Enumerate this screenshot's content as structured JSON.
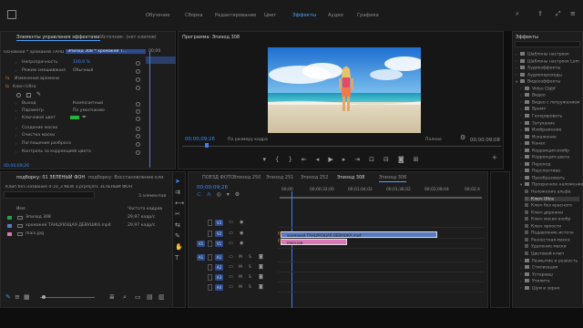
{
  "workspaces": [
    "Обучение",
    "Сборка",
    "Редактирование",
    "Цвет",
    "Эффекты",
    "Аудио",
    "Графика"
  ],
  "active_workspace": "Эффекты",
  "effect_controls": {
    "tabs": [
      "Элементы управления эффектами",
      "Источник: (нет клипов)"
    ],
    "header_master": "Основной * хромакей ТАНЦ...",
    "header_seq": "Эпизод 308 * хромакей Т...",
    "timecode_top": "00;00",
    "rows": [
      {
        "label": "Непрозрачность",
        "value": "100,0 %"
      },
      {
        "label": "Режим смешивания",
        "value": "Обычный"
      },
      {
        "label": "Изменение времени",
        "value": ""
      },
      {
        "label": "Ключ Ultra",
        "value": ""
      },
      {
        "label": "Выход",
        "value": "Композитный"
      },
      {
        "label": "Параметр",
        "value": "По умолчанию"
      },
      {
        "label": "Ключевой цвет",
        "value": ""
      },
      {
        "label": "Создание маски",
        "value": ""
      },
      {
        "label": "Очистка маски",
        "value": ""
      },
      {
        "label": "Поглощение разброса",
        "value": ""
      },
      {
        "label": "Контроль за коррекцией цвета",
        "value": ""
      },
      {
        "label": "Коррекция цвета",
        "value": ""
      }
    ],
    "timecode": "00;00;09;26"
  },
  "program": {
    "title": "Программа: Эпизод 308",
    "timecode": "00;00;09;26",
    "fit": "По размеру кадра",
    "quality": "Полное",
    "duration": "00;00;09;08"
  },
  "project": {
    "tabs": [
      "подборку: 01 ЗЕЛЕНЫЙ ФОН",
      "подборку: Восстановление кли"
    ],
    "path": "Клип без названия 4-10_3 NEW 3.prproj\\01 ЗЕЛЕНЫЙ ФОН",
    "count": "3 элементов",
    "col_name": "Имя",
    "col_rate": "Частота кадров",
    "items": [
      {
        "name": "Эпизод 308",
        "rate": "29,97 кадр/с",
        "color": "#2e9b4a"
      },
      {
        "name": "хромакей ТАНЦУЮЩАЯ ДЕВУШКА.mp4",
        "rate": "29,97 кадр/с",
        "color": "#5a7ac0"
      },
      {
        "name": "main.jpg",
        "rate": "",
        "color": "#d977b8"
      }
    ]
  },
  "timeline": {
    "tabs": [
      "ПОЕЗД ФОТО",
      "Эпизод 250",
      "Эпизод 251",
      "Эпизод 252",
      "Эпизод 308",
      "Эпизод 306"
    ],
    "active_tab": "Эпизод 308",
    "timecode": "00;00;09;26",
    "ruler": [
      "00;00",
      "00;00;32;00",
      "00;01;04;02",
      "00;01;36;02",
      "00;02;08;04",
      "00;02;4"
    ],
    "video_tracks": [
      "V3",
      "V2",
      "V1"
    ],
    "audio_tracks": [
      "A1",
      "A2",
      "A3",
      "A4"
    ],
    "source_v": "V1",
    "source_a": "A1",
    "clips": [
      {
        "name": "хромакей ТАНЦУЮЩАЯ ДЕВУШКА.mp4",
        "track": "V2",
        "color": "#5a7ac0"
      },
      {
        "name": "main.jpg",
        "track": "V1",
        "color": "#d977b8"
      }
    ]
  },
  "effects": {
    "title": "Эффекты",
    "items": [
      {
        "label": "Шаблоны настроек",
        "kind": "folder",
        "indent": 1
      },
      {
        "label": "Шаблоны настроек Lum",
        "kind": "folder",
        "indent": 1
      },
      {
        "label": "Аудиоэффекты",
        "kind": "folder",
        "indent": 1
      },
      {
        "label": "Аудиопереходы",
        "kind": "folder",
        "indent": 1
      },
      {
        "label": "Видеоэффекты",
        "kind": "folder",
        "indent": 1
      },
      {
        "label": "Video Cbjbf",
        "kind": "folder",
        "indent": 2
      },
      {
        "label": "Видео",
        "kind": "folder",
        "indent": 2
      },
      {
        "label": "Видео с погружением",
        "kind": "folder",
        "indent": 2
      },
      {
        "label": "Время",
        "kind": "folder",
        "indent": 2
      },
      {
        "label": "Генерировать",
        "kind": "folder",
        "indent": 2
      },
      {
        "label": "Затухание",
        "kind": "folder",
        "indent": 2
      },
      {
        "label": "Изображение",
        "kind": "folder",
        "indent": 2
      },
      {
        "label": "Искажение",
        "kind": "folder",
        "indent": 2
      },
      {
        "label": "Канал",
        "kind": "folder",
        "indent": 2
      },
      {
        "label": "Коррекция изобр",
        "kind": "folder",
        "indent": 2
      },
      {
        "label": "Коррекция цвета",
        "kind": "folder",
        "indent": 2
      },
      {
        "label": "Переход",
        "kind": "folder",
        "indent": 2
      },
      {
        "label": "Перспектива",
        "kind": "folder",
        "indent": 2
      },
      {
        "label": "Преобразовать",
        "kind": "folder",
        "indent": 2
      },
      {
        "label": "Прозрачное наложение",
        "kind": "folder",
        "indent": 2
      },
      {
        "label": "Наложение альфа",
        "kind": "item",
        "indent": 3
      },
      {
        "label": "Ключ Ultra",
        "kind": "item",
        "indent": 3
      },
      {
        "label": "Ключ без красного",
        "kind": "item",
        "indent": 3
      },
      {
        "label": "Ключ дорожки",
        "kind": "item",
        "indent": 3
      },
      {
        "label": "Ключ маски изобр",
        "kind": "item",
        "indent": 3
      },
      {
        "label": "Ключ яркости",
        "kind": "item",
        "indent": 3
      },
      {
        "label": "Подавление источн",
        "kind": "item",
        "indent": 3
      },
      {
        "label": "Разностная маска",
        "kind": "item",
        "indent": 3
      },
      {
        "label": "Удаление маски",
        "kind": "item",
        "indent": 3
      },
      {
        "label": "Цветовой ключ",
        "kind": "item",
        "indent": 3
      },
      {
        "label": "Размытие и резкость",
        "kind": "folder",
        "indent": 2
      },
      {
        "label": "Стилизация",
        "kind": "folder",
        "indent": 2
      },
      {
        "label": "Устаревш",
        "kind": "folder",
        "indent": 2
      },
      {
        "label": "Утилита",
        "kind": "folder",
        "indent": 2
      },
      {
        "label": "Шум и зерно",
        "kind": "folder",
        "indent": 2
      }
    ],
    "selected": "Ключ Ultra"
  }
}
